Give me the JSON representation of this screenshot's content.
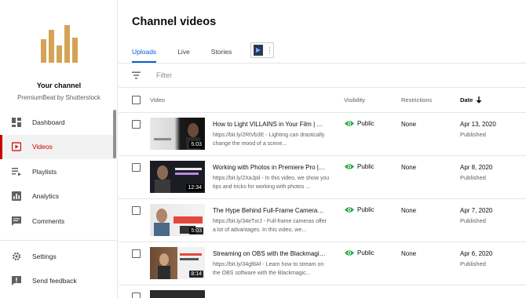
{
  "sidebar": {
    "channel_name": "Your channel",
    "channel_sub": "PremiumBeat by Shutterstock",
    "items": [
      {
        "label": "Dashboard",
        "icon": "dashboard-icon"
      },
      {
        "label": "Videos",
        "icon": "videos-icon",
        "active": true
      },
      {
        "label": "Playlists",
        "icon": "playlists-icon"
      },
      {
        "label": "Analytics",
        "icon": "analytics-icon"
      },
      {
        "label": "Comments",
        "icon": "comments-icon"
      }
    ],
    "bottom_items": [
      {
        "label": "Settings",
        "icon": "gear-icon"
      },
      {
        "label": "Send feedback",
        "icon": "feedback-icon"
      }
    ]
  },
  "main": {
    "title": "Channel videos",
    "tabs": [
      {
        "label": "Uploads",
        "active": true
      },
      {
        "label": "Live"
      },
      {
        "label": "Stories"
      }
    ],
    "filter_placeholder": "Filter",
    "columns": {
      "video": "Video",
      "visibility": "Visibility",
      "restrictions": "Restrictions",
      "date": "Date"
    },
    "rows": [
      {
        "title": "How to Light VILLAINS in Your Film | Cin...",
        "desc": "https://bit.ly/2RtVb3E - Lighting can drastically change the mood of a scene...",
        "duration": "5:03",
        "visibility": "Public",
        "restrictions": "None",
        "date": "Apr 13, 2020",
        "status": "Published",
        "thumb_caption": "LIGHTING VILLAINS"
      },
      {
        "title": "Working with Photos in Premiere Pro | Vi...",
        "desc": "https://bit.ly/2XaJpil - In this video, we show you tips and tricks for working with photos ...",
        "duration": "12:34",
        "visibility": "Public",
        "restrictions": "None",
        "date": "Apr 8, 2020",
        "status": "Published",
        "thumb_caption": "WORKING WITH PHOTOS IN PREMIERE PRO"
      },
      {
        "title": "The Hype Behind Full-Frame Cameras | G...",
        "desc": "https://bit.ly/34eTxrJ - Full-frame cameras offer a lot of advantages. In this video, we...",
        "duration": "5:03",
        "visibility": "Public",
        "restrictions": "None",
        "date": "Apr 7, 2020",
        "status": "Published",
        "thumb_caption": "FULL FRAME"
      },
      {
        "title": "Streaming on OBS with the Blackmagic ...",
        "desc": "https://bit.ly/34gf8Af - Learn how to stream on the OBS software with the Blackmagic...",
        "duration": "8:14",
        "visibility": "Public",
        "restrictions": "None",
        "date": "Apr 6, 2020",
        "status": "Published",
        "thumb_caption": ""
      }
    ]
  },
  "colors": {
    "accent_red": "#cc0000",
    "link_blue": "#065fd4",
    "public_green": "#2ba640",
    "logo_gold": "#d4a356"
  }
}
